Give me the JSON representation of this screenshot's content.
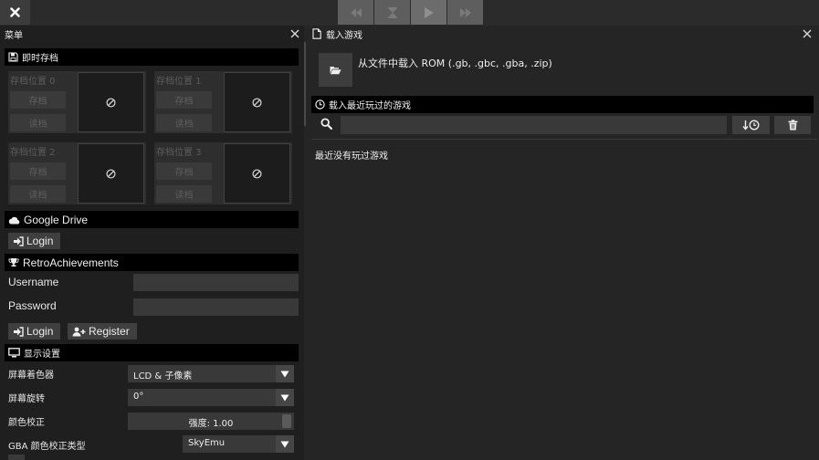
{
  "toolbar": {
    "close_icon": "close-icon",
    "controls": [
      "rewind-icon",
      "hourglass-icon",
      "play-icon",
      "fast-forward-icon"
    ]
  },
  "menu_panel": {
    "title": "菜单",
    "save_states": {
      "title": "即时存档",
      "slots": [
        {
          "label": "存档位置 0",
          "save": "存档",
          "load": "读档"
        },
        {
          "label": "存档位置 1",
          "save": "存档",
          "load": "读档"
        },
        {
          "label": "存档位置 2",
          "save": "存档",
          "load": "读档"
        },
        {
          "label": "存档位置 3",
          "save": "存档",
          "load": "读档"
        }
      ]
    },
    "google_drive": {
      "title": "Google Drive",
      "login": "Login"
    },
    "retro_achievements": {
      "title": "RetroAchievements",
      "username_label": "Username",
      "password_label": "Password",
      "login": "Login",
      "register": "Register"
    },
    "display": {
      "title": "显示设置",
      "shader_label": "屏幕着色器",
      "shader_value": "LCD & 子像素",
      "rotation_label": "屏幕旋转",
      "rotation_value": "0°",
      "color_label": "颜色校正",
      "color_value": "强度: 1.00",
      "gba_label": "GBA 颜色校正类型",
      "gba_value": "SkyEmu"
    }
  },
  "load_panel": {
    "title": "载入游戏",
    "load_file": "从文件中载入 ROM (.gb, .gbc, .gba, .zip)",
    "recent_title": "载入最近玩过的游戏",
    "search_placeholder": "",
    "empty_text": "最近没有玩过游戏"
  }
}
